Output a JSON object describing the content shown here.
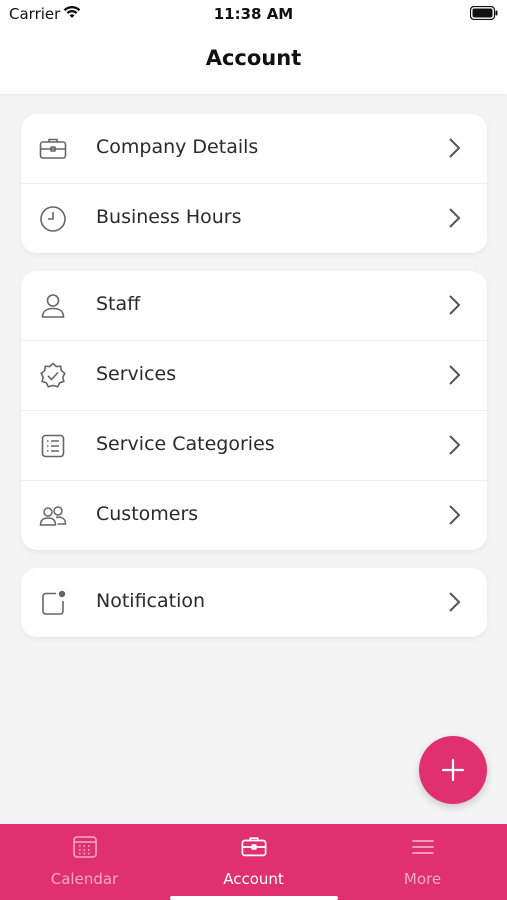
{
  "status_bar": {
    "carrier": "Carrier",
    "time": "11:38 AM"
  },
  "header": {
    "title": "Account"
  },
  "sections": [
    {
      "items": [
        {
          "label": "Company Details",
          "icon": "briefcase-icon"
        },
        {
          "label": "Business Hours",
          "icon": "clock-icon"
        }
      ]
    },
    {
      "items": [
        {
          "label": "Staff",
          "icon": "person-icon"
        },
        {
          "label": "Services",
          "icon": "verified-badge-icon"
        },
        {
          "label": "Service Categories",
          "icon": "list-icon"
        },
        {
          "label": "Customers",
          "icon": "people-icon"
        }
      ]
    },
    {
      "items": [
        {
          "label": "Notification",
          "icon": "notification-icon"
        }
      ]
    }
  ],
  "fab": {
    "icon": "plus-icon"
  },
  "tab_bar": {
    "tabs": [
      {
        "label": "Calendar",
        "icon": "calendar-icon",
        "active": false
      },
      {
        "label": "Account",
        "icon": "briefcase-icon",
        "active": true
      },
      {
        "label": "More",
        "icon": "menu-icon",
        "active": false
      }
    ]
  },
  "colors": {
    "accent": "#e0306d",
    "background": "#f4f4f4",
    "card": "#ffffff"
  }
}
